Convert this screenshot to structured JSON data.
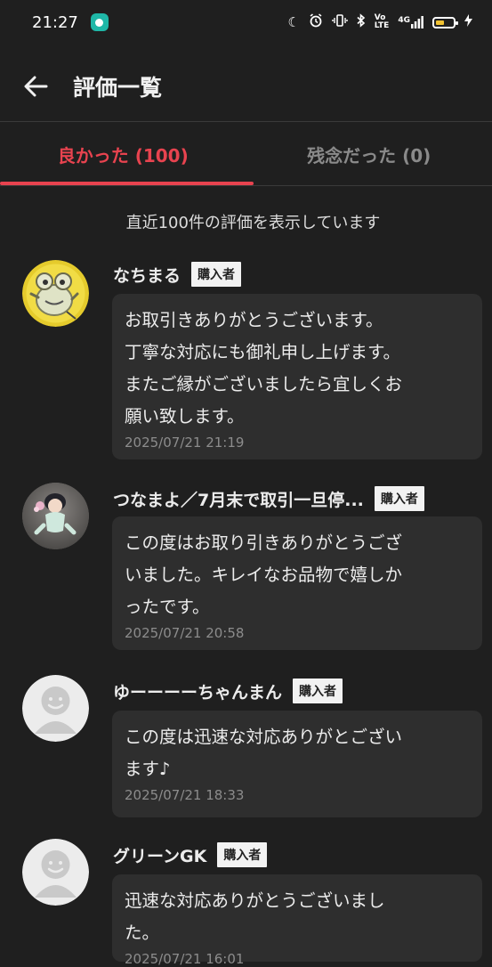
{
  "status_bar": {
    "time": "21:27",
    "icons": [
      "chat-app-icon",
      "do-not-disturb-moon-icon",
      "alarm-icon",
      "vibrate-icon",
      "bluetooth-icon",
      "volte-icon",
      "4g-signal-icon",
      "battery-icon",
      "charging-icon"
    ],
    "network_text": "4G"
  },
  "header": {
    "title": "評価一覧",
    "back_icon": "arrow-left-icon"
  },
  "tabs": [
    {
      "label": "良かった (100)",
      "active": true
    },
    {
      "label": "残念だった (0)",
      "active": false
    }
  ],
  "notice": "直近100件の評価を表示しています",
  "badge_label": "購入者",
  "colors": {
    "background": "#1f1f1f",
    "accent": "#e8434f",
    "bubble": "#2e2e2e",
    "badge_bg": "#f2f2f2"
  },
  "reviews": [
    {
      "name": "なちまる",
      "avatar": "frog-character-avatar",
      "comment": "お取引きありがとうございます。\n丁寧な対応にも御礼申し上げます。\nまたご縁がございましたら宜しくお\n願い致します。",
      "date": "2025/07/21 21:19"
    },
    {
      "name": "つなまよ／7月末で取引一旦停...",
      "avatar": "figurine-photo-avatar",
      "comment": "この度はお取り引きありがとうござ\nいました。キレイなお品物で嬉しか\nったです。",
      "date": "2025/07/21 20:58"
    },
    {
      "name": "ゆーーーーちゃんまん",
      "avatar": "default-user-avatar",
      "comment": "この度は迅速な対応ありがとござい\nます♪",
      "date": "2025/07/21 18:33"
    },
    {
      "name": "グリーンGK",
      "avatar": "default-user-avatar",
      "comment": "迅速な対応ありがとうございまし\nた。",
      "date": "2025/07/21 16:01"
    }
  ]
}
